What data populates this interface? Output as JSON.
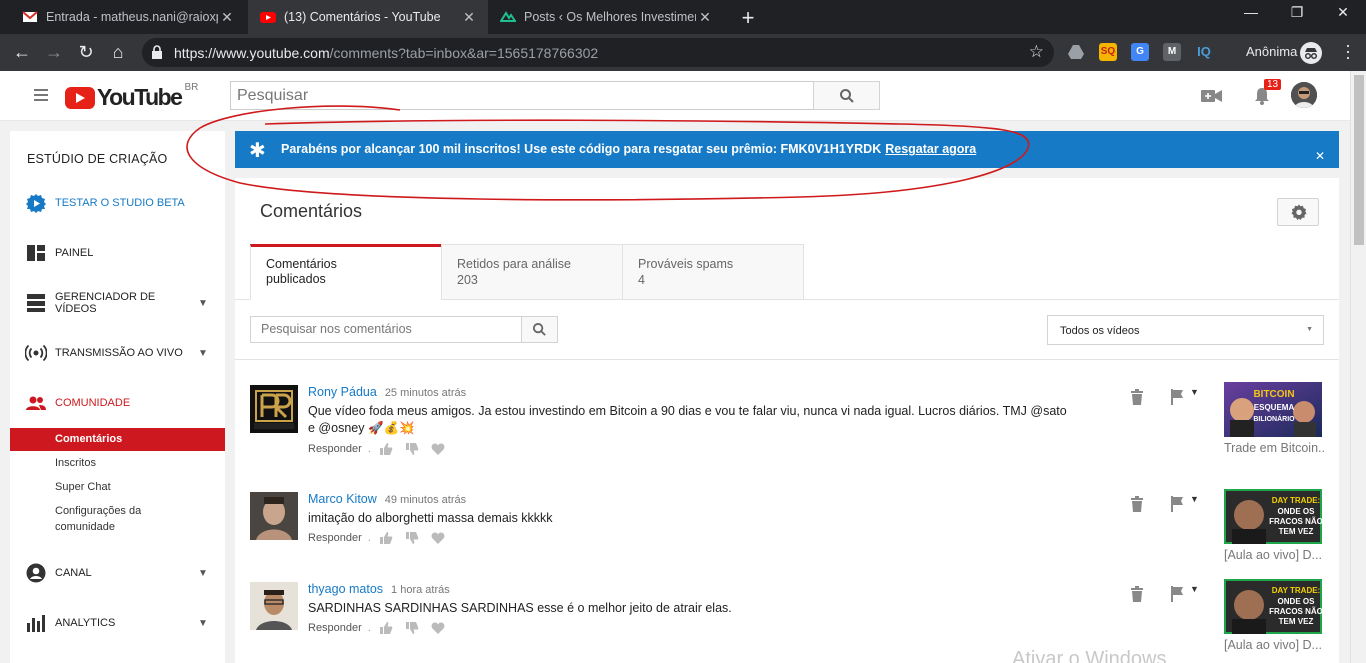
{
  "browser": {
    "tabs": [
      {
        "title": "Entrada - matheus.nani@raioxpre",
        "close": "✕"
      },
      {
        "title": "(13) Comentários - YouTube",
        "close": "✕"
      },
      {
        "title": "Posts ‹ Os Melhores Investimento",
        "close": "✕"
      }
    ],
    "new_tab": "+",
    "url_host": "https://www.youtube.com",
    "url_path": "/comments?tab=inbox&ar=1565178766302",
    "profile_label": "Anônima",
    "extensions": [
      "drive-icon",
      "sq-icon",
      "translate-icon",
      "m-icon",
      "iq-icon"
    ],
    "ext_labels": {
      "sq": "SQ",
      "m": "M",
      "iq": "IQ"
    }
  },
  "youtube": {
    "logo_text": "YouTube",
    "country": "BR",
    "search_placeholder": "Pesquisar",
    "notification_count": "13"
  },
  "sidebar": {
    "heading": "ESTÚDIO DE CRIAÇÃO",
    "items": [
      {
        "label": "TESTAR O STUDIO BETA",
        "icon": "gear-icon",
        "accent": true
      },
      {
        "label": "PAINEL",
        "icon": "dashboard-icon"
      },
      {
        "label": "GERENCIADOR DE VÍDEOS",
        "icon": "video-manager-icon",
        "chevron": true
      },
      {
        "label": "TRANSMISSÃO AO VIVO",
        "icon": "live-icon",
        "chevron": true
      },
      {
        "label": "COMUNIDADE",
        "icon": "community-icon",
        "accent": true
      },
      {
        "label": "CANAL",
        "icon": "channel-icon",
        "chevron": true
      },
      {
        "label": "ANALYTICS",
        "icon": "analytics-icon",
        "chevron": true
      }
    ],
    "community_sub": [
      "Comentários",
      "Inscritos",
      "Super Chat",
      "Configurações da comunidade"
    ]
  },
  "banner": {
    "message": "Parabéns por alcançar 100 mil inscritos! Use este código para resgatar seu prêmio: FMK0V1H1YRDK",
    "link": "Resgatar agora",
    "close": "✕"
  },
  "main": {
    "title": "Comentários",
    "tabs": [
      {
        "label": "Comentários publicados",
        "count": ""
      },
      {
        "label": "Retidos para análise",
        "count": "203"
      },
      {
        "label": "Prováveis spams",
        "count": "4"
      }
    ],
    "search_placeholder": "Pesquisar nos comentários",
    "filter_value": "Todos os vídeos",
    "reply_label": "Responder"
  },
  "comments": [
    {
      "author": "Rony Pádua",
      "time": "25 minutos atrás",
      "text": "Que vídeo foda meus amigos. Ja estou investindo em Bitcoin a 90 dias e vou te falar viu, nunca vi nada igual. Lucros diários. TMJ @sato e @osney 🚀💰💥",
      "video_title": "Trade em Bitcoin...",
      "thumb_text": "BITCOIN ESQUEMA BILIONÁRIO"
    },
    {
      "author": "Marco Kitow",
      "time": "49 minutos atrás",
      "text": "imitação do alborghetti massa demais kkkkk",
      "video_title": "[Aula ao vivo] D...",
      "thumb_text": "DAY TRADE: ONDE OS FRACOS NÃO TEM VEZ"
    },
    {
      "author": "thyago matos",
      "time": "1 hora atrás",
      "text": "SARDINHAS SARDINHAS SARDINHAS esse é o melhor jeito de atrair elas.",
      "video_title": "[Aula ao vivo] D...",
      "thumb_text": "DAY TRADE: ONDE OS FRACOS NÃO TEM VEZ"
    }
  ],
  "watermark": "Ativar o Windows",
  "colors": {
    "youtube_red": "#e62117",
    "banner_blue": "#167ac6",
    "active_sidebar": "#cc181e",
    "annotation_red": "#d0191b"
  }
}
